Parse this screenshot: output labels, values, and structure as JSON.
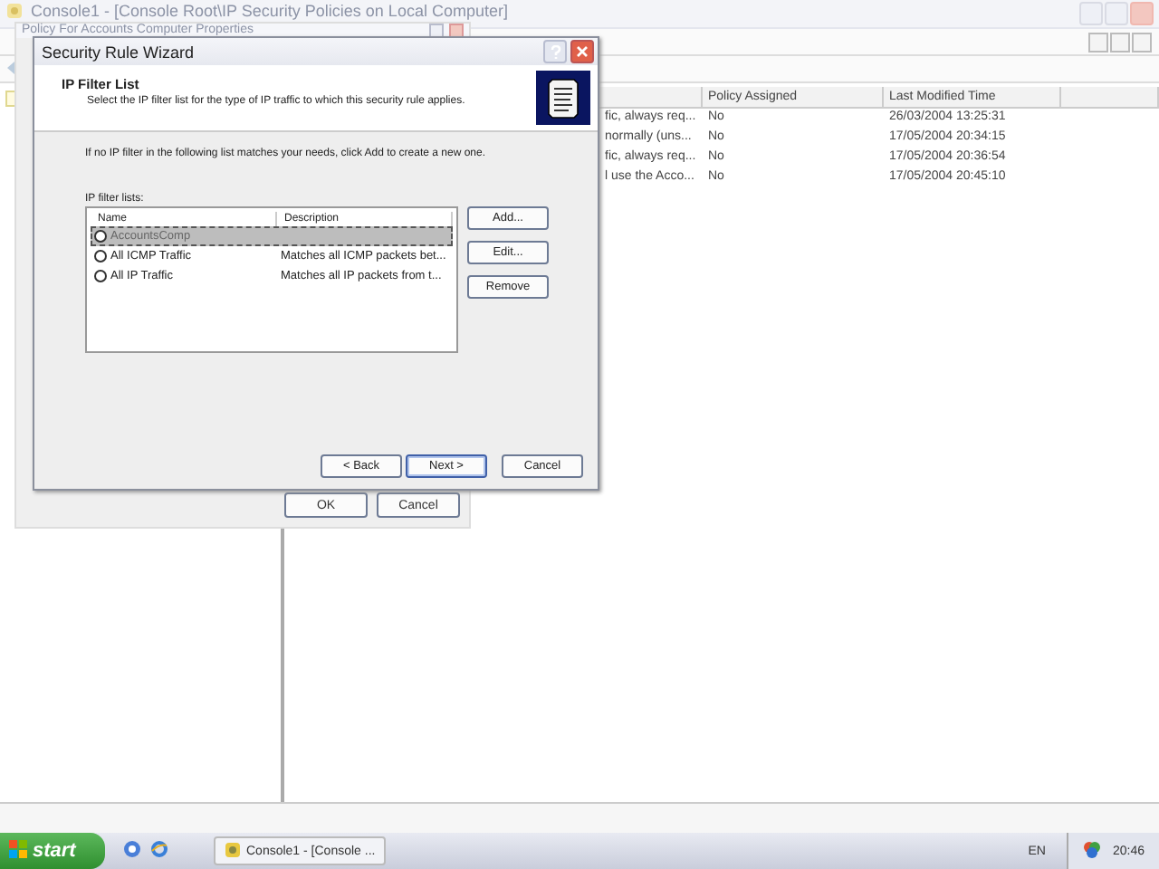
{
  "console": {
    "title": "Console1 - [Console Root\\IP Security Policies on Local Computer]",
    "columns": [
      "Policy Assigned",
      "Last Modified Time"
    ],
    "rows": [
      {
        "column_1": "fic, always req...",
        "policy_assigned": "No",
        "last_modified_time": "26/03/2004 13:25:31"
      },
      {
        "column_1": "normally (uns...",
        "policy_assigned": "No",
        "last_modified_time": "17/05/2004 20:34:15"
      },
      {
        "column_1": "fic, always req...",
        "policy_assigned": "No",
        "last_modified_time": "17/05/2004 20:36:54"
      },
      {
        "column_1": "l use the Acco...",
        "policy_assigned": "No",
        "last_modified_time": "17/05/2004 20:45:10"
      }
    ]
  },
  "properties_dialog": {
    "title": "Policy For Accounts Computer Properties",
    "buttons": [
      "OK",
      "Cancel"
    ]
  },
  "wizard": {
    "title": "Security Rule Wizard",
    "heading": "IP Filter List",
    "subheading": "Select the IP filter list for the type of IP traffic to which this security rule applies.",
    "instruction": "If no IP filter in the following list matches your needs, click Add to create a new one.",
    "list_label": "IP filter lists:",
    "columns": [
      "Name",
      "Description"
    ],
    "filters": [
      {
        "name": "AccountsComp",
        "selected": true,
        "checked": false
      },
      {
        "name": "All ICMP Traffic",
        "description": "Matches all ICMP packets bet...",
        "selected": false,
        "checked": false
      },
      {
        "name": "All IP Traffic",
        "description": "Matches all IP packets from t...",
        "selected": false,
        "checked": false
      }
    ],
    "side_buttons": [
      "Add...",
      "Edit...",
      "Remove"
    ],
    "nav_buttons": [
      {
        "label": "< Back",
        "default": false
      },
      {
        "label": "Next >",
        "default": true
      },
      {
        "label": "Cancel",
        "default": false
      }
    ]
  },
  "taskbar": {
    "start": "start",
    "task": "Console1 - [Console ...",
    "language": "EN",
    "clock": "20:46"
  }
}
